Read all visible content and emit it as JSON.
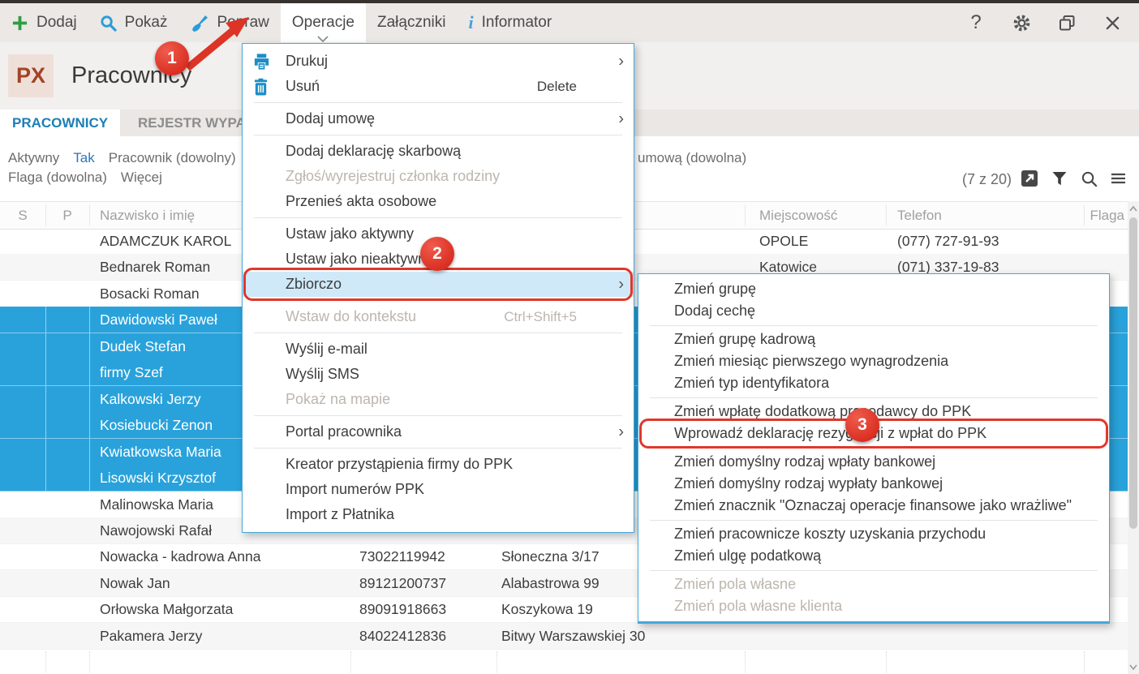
{
  "window": {
    "badge": "PX",
    "title": "Pracownicy"
  },
  "toolbar": {
    "items": [
      {
        "label": "Dodaj",
        "icon": "plus"
      },
      {
        "label": "Pokaż",
        "icon": "search"
      },
      {
        "label": "Popraw",
        "icon": "brush"
      },
      {
        "label": "Operacje",
        "icon": null,
        "active": true,
        "chevron": true
      },
      {
        "label": "Załączniki",
        "icon": null
      },
      {
        "label": "Informator",
        "icon": "info"
      }
    ],
    "window_controls": [
      {
        "icon": "help",
        "glyph": "?"
      },
      {
        "icon": "settings",
        "glyph": ""
      },
      {
        "icon": "restore",
        "glyph": ""
      },
      {
        "icon": "close",
        "glyph": ""
      }
    ]
  },
  "tabs": [
    {
      "label": "PRACOWNICY",
      "active": true
    },
    {
      "label": "REJESTR WYPA",
      "active": false
    }
  ],
  "filter_bar": {
    "line1": [
      {
        "text": "Aktywny"
      },
      {
        "text": "Tak",
        "accent": true
      },
      {
        "text": "Pracownik (dowolny)"
      },
      {
        "text": "("
      }
    ],
    "line2": [
      {
        "text": "Flaga (dowolna)"
      },
      {
        "text": "Więcej"
      }
    ],
    "right_fragment": "umową (dowolna)",
    "count": "(7 z 20)",
    "tool_icons": [
      "open-in-new",
      "filter",
      "search-small",
      "hamburger"
    ]
  },
  "table": {
    "columns": [
      {
        "key": "s",
        "label": "S"
      },
      {
        "key": "p",
        "label": "P"
      },
      {
        "key": "name",
        "label": "Nazwisko i imię"
      },
      {
        "key": "city",
        "label": "Miejscowość"
      },
      {
        "key": "phone",
        "label": "Telefon"
      },
      {
        "key": "flag",
        "label": "Flaga"
      }
    ],
    "rows": [
      {
        "name": "ADAMCZUK KAROL",
        "pesel": "",
        "address": "",
        "city": "OPOLE",
        "phone": "(077) 727-91-93",
        "selected": false
      },
      {
        "name": "Bednarek Roman",
        "pesel": "",
        "address": "",
        "city": "Katowice",
        "phone": "(071) 337-19-83",
        "selected": false
      },
      {
        "name": "Bosacki Roman",
        "pesel": "",
        "address": "",
        "city": "",
        "phone": "",
        "selected": false
      },
      {
        "name": "Dawidowski Paweł",
        "pesel": "",
        "address": "",
        "city": "",
        "phone": "",
        "selected": true
      },
      {
        "name": "Dudek Stefan",
        "pesel": "",
        "address": "",
        "city": "",
        "phone": "",
        "selected": true
      },
      {
        "name": "firmy Szef",
        "pesel": "",
        "address": "",
        "city": "",
        "phone": "",
        "selected": true
      },
      {
        "name": "Kalkowski Jerzy",
        "pesel": "",
        "address": "",
        "city": "",
        "phone": "",
        "selected": true
      },
      {
        "name": "Kosiebucki Zenon",
        "pesel": "",
        "address": "",
        "city": "",
        "phone": "",
        "selected": true
      },
      {
        "name": "Kwiatkowska Maria",
        "pesel": "",
        "address": "",
        "city": "",
        "phone": "",
        "selected": true
      },
      {
        "name": "Lisowski Krzysztof",
        "pesel": "",
        "address": "",
        "city": "",
        "phone": "",
        "selected": true
      },
      {
        "name": "Malinowska Maria",
        "pesel": "",
        "address": "",
        "city": "",
        "phone": "",
        "selected": false
      },
      {
        "name": "Nawojowski Rafał",
        "pesel": "",
        "address": "",
        "city": "",
        "phone": "",
        "selected": false
      },
      {
        "name": "Nowacka - kadrowa Anna",
        "pesel": "73022119942",
        "address": "Słoneczna 3/17",
        "city": "",
        "phone": "",
        "selected": false
      },
      {
        "name": "Nowak Jan",
        "pesel": "89121200737",
        "address": "Alabastrowa 99",
        "city": "",
        "phone": "",
        "selected": false
      },
      {
        "name": "Orłowska Małgorzata",
        "pesel": "89091918663",
        "address": "Koszykowa 19",
        "city": "",
        "phone": "",
        "selected": false
      },
      {
        "name": "Pakamera Jerzy",
        "pesel": "84022412836",
        "address": "Bitwy Warszawskiej 30",
        "city": "",
        "phone": "",
        "selected": false
      }
    ]
  },
  "menu1": {
    "items": [
      {
        "label": "Drukuj",
        "icon": "printer",
        "arrow": true
      },
      {
        "label": "Usuń",
        "icon": "trash",
        "shortcut": "Delete"
      },
      {
        "sep": true
      },
      {
        "label": "Dodaj umowę",
        "arrow": true
      },
      {
        "sep": true
      },
      {
        "label": "Dodaj deklarację skarbową"
      },
      {
        "label": "Zgłoś/wyrejestruj członka rodziny",
        "disabled": true
      },
      {
        "label": "Przenieś akta osobowe"
      },
      {
        "sep": true
      },
      {
        "label": "Ustaw jako aktywny"
      },
      {
        "label": "Ustaw jako nieaktywny"
      },
      {
        "label": "Zbiorczo",
        "arrow": true,
        "highlighted": true,
        "annotated": true
      },
      {
        "sep": true
      },
      {
        "label": "Wstaw do kontekstu",
        "disabled": true,
        "shortcut": "Ctrl+Shift+5"
      },
      {
        "sep": true
      },
      {
        "label": "Wyślij e-mail"
      },
      {
        "label": "Wyślij SMS"
      },
      {
        "label": "Pokaż na mapie",
        "disabled": true
      },
      {
        "sep": true
      },
      {
        "label": "Portal pracownika",
        "arrow": true
      },
      {
        "sep": true
      },
      {
        "label": "Kreator przystąpienia firmy do PPK"
      },
      {
        "label": "Import numerów PPK"
      },
      {
        "label": "Import z Płatnika"
      }
    ]
  },
  "menu2": {
    "items": [
      {
        "label": "Zmień grupę"
      },
      {
        "label": "Dodaj cechę"
      },
      {
        "sep": true
      },
      {
        "label": "Zmień grupę kadrową"
      },
      {
        "label": "Zmień miesiąc pierwszego wynagrodzenia"
      },
      {
        "label": "Zmień typ identyfikatora"
      },
      {
        "sep": true
      },
      {
        "label": "Zmień wpłatę dodatkową pracodawcy do PPK"
      },
      {
        "label": "Wprowadź deklarację rezygnacji z wpłat do PPK",
        "annotated": true
      },
      {
        "sep": true
      },
      {
        "label": "Zmień domyślny rodzaj wpłaty bankowej"
      },
      {
        "label": "Zmień domyślny rodzaj wypłaty bankowej"
      },
      {
        "label": "Zmień znacznik \"Oznaczaj operacje finansowe jako wrażliwe\""
      },
      {
        "sep": true
      },
      {
        "label": "Zmień pracownicze koszty uzyskania przychodu"
      },
      {
        "label": "Zmień ulgę podatkową"
      },
      {
        "sep": true
      },
      {
        "label": "Zmień pola własne",
        "disabled": true
      },
      {
        "label": "Zmień pola własne klienta",
        "disabled": true
      }
    ]
  },
  "annotations": {
    "step1": "1",
    "step2": "2",
    "step3": "3"
  },
  "colors": {
    "selection": "#29a2db",
    "menu_border": "#44a8da",
    "annotation_red": "#d92d20",
    "accent_blue": "#1b7fb5"
  }
}
